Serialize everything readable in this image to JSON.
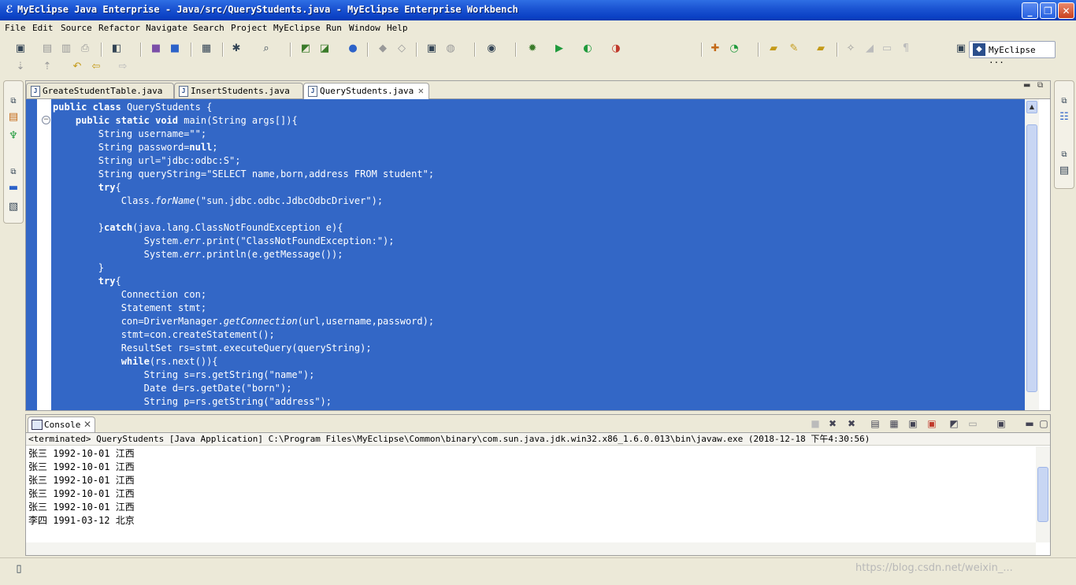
{
  "window": {
    "title": "MyEclipse Java Enterprise - Java/src/QueryStudents.java - MyEclipse Enterprise Workbench",
    "minimize": "_",
    "maximize": "❐",
    "close": "✕"
  },
  "menu": [
    "File",
    "Edit",
    "Source",
    "Refactor",
    "Navigate",
    "Search",
    "Project",
    "MyEclipse",
    "Run",
    "Window",
    "Help"
  ],
  "perspective": {
    "label": "MyEclipse ..."
  },
  "editor": {
    "tabs": [
      {
        "label": "GreateStudentTable.java",
        "active": false
      },
      {
        "label": "InsertStudents.java",
        "active": false
      },
      {
        "label": "QueryStudents.java",
        "active": true
      }
    ],
    "code_lines": [
      "public class QueryStudents {",
      "    public static void main(String args[]){",
      "        String username=\"\";",
      "        String password=null;",
      "        String url=\"jdbc:odbc:S\";",
      "        String queryString=\"SELECT name,born,address FROM student\";",
      "        try{",
      "            Class.forName(\"sun.jdbc.odbc.JdbcOdbcDriver\");",
      "",
      "        }catch(java.lang.ClassNotFoundException e){",
      "                System.err.print(\"ClassNotFoundException:\");",
      "                System.err.println(e.getMessage());",
      "        }",
      "        try{",
      "            Connection con;",
      "            Statement stmt;",
      "            con=DriverManager.getConnection(url,username,password);",
      "            stmt=con.createStatement();",
      "            ResultSet rs=stmt.executeQuery(queryString);",
      "            while(rs.next()){",
      "                String s=rs.getString(\"name\");",
      "                Date d=rs.getDate(\"born\");",
      "                String p=rs.getString(\"address\");"
    ]
  },
  "console": {
    "tab_label": "Console",
    "status": "<terminated> QueryStudents [Java Application] C:\\Program Files\\MyEclipse\\Common\\binary\\com.sun.java.jdk.win32.x86_1.6.0.013\\bin\\javaw.exe (2018-12-18 下午4:30:56)",
    "output": [
      "张三 1992-10-01 江西",
      "张三 1992-10-01 江西",
      "张三 1992-10-01 江西",
      "张三 1992-10-01 江西",
      "张三 1992-10-01 江西",
      "李四 1991-03-12 北京"
    ]
  },
  "watermark": "https://blog.csdn.net/weixin_..."
}
